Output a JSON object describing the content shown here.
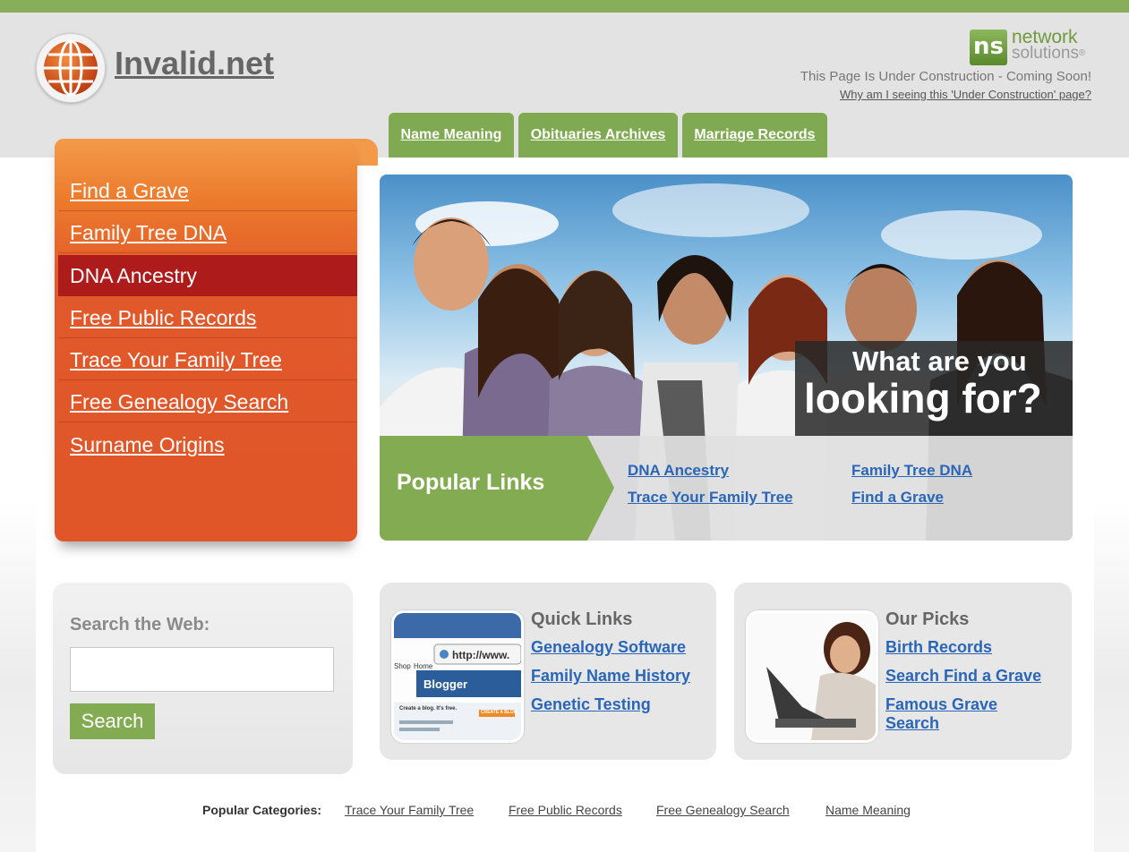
{
  "header": {
    "site_title": "Invalid.net",
    "ns_logo_mark": "ns",
    "ns_logo_word1": "network",
    "ns_logo_word2": "solutions",
    "ns_logo_reg": "®",
    "under_construction": "This Page Is Under Construction - Coming Soon!",
    "why_link": "Why am I seeing this 'Under Construction' page?"
  },
  "tabs": [
    {
      "label": "Name Meaning"
    },
    {
      "label": "Obituaries Archives"
    },
    {
      "label": "Marriage Records"
    }
  ],
  "sidebar": {
    "items": [
      {
        "label": "Find a Grave"
      },
      {
        "label": "Family Tree DNA"
      },
      {
        "label": "DNA Ancestry"
      },
      {
        "label": "Free Public Records"
      },
      {
        "label": "Trace Your Family Tree"
      },
      {
        "label": "Free Genealogy Search"
      },
      {
        "label": "Surname Origins"
      }
    ],
    "active_index": 2
  },
  "hero": {
    "looking_for_line1": "What are you",
    "looking_for_line2": "looking for?",
    "popular_title": "Popular Links",
    "popular_links": [
      {
        "label": "DNA Ancestry"
      },
      {
        "label": "Family Tree DNA"
      },
      {
        "label": "Trace Your Family Tree"
      },
      {
        "label": "Find a Grave"
      }
    ]
  },
  "search": {
    "label": "Search the Web:",
    "input_value": "",
    "button_label": "Search"
  },
  "quick_links": {
    "title": "Quick Links",
    "thumb_url_text": "http://www.",
    "thumb_brand": "Blogger",
    "thumb_nav_1": "Shop",
    "thumb_nav_2": "Home",
    "thumb_caption": "Create a blog. It's free.",
    "thumb_btn": "CREATE A BLOG",
    "links": [
      {
        "label": "Genealogy Software"
      },
      {
        "label": "Family Name History"
      },
      {
        "label": "Genetic Testing"
      }
    ]
  },
  "our_picks": {
    "title": "Our Picks",
    "links": [
      {
        "label": "Birth Records"
      },
      {
        "label": "Search Find a Grave"
      },
      {
        "label": "Famous Grave Search"
      }
    ]
  },
  "footer": {
    "label": "Popular Categories:",
    "links": [
      {
        "label": "Trace Your Family Tree"
      },
      {
        "label": "Free Public Records"
      },
      {
        "label": "Free Genealogy Search"
      },
      {
        "label": "Name Meaning"
      }
    ]
  },
  "colors": {
    "accent_green": "#82ab52",
    "sidebar_orange": "#e05628",
    "active_red": "#ad1b1b",
    "link_blue": "#2a66b8"
  }
}
